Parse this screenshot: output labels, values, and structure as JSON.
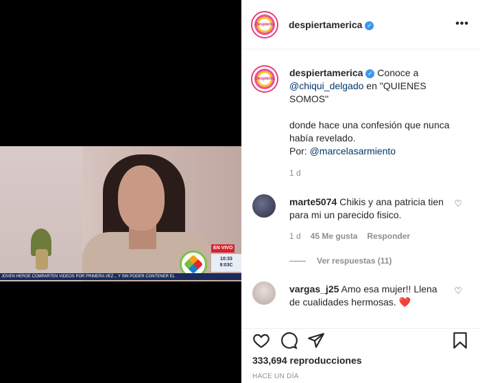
{
  "video": {
    "live_label": "EN VIVO",
    "clock_line1": "10:33",
    "clock_line2": "9:03C",
    "ticker": "JOVEN HEROE COMPARTEN VIDEOS POR PRIMERA VEZ... Y SIN PODER CONTENER EL"
  },
  "header": {
    "username": "despiertamerica",
    "avatar_text": "Despierta",
    "more": "•••"
  },
  "caption": {
    "username": "despiertamerica",
    "text_before": " Conoce a ",
    "mention1": "@chiqui_delgado",
    "text_mid": " en \"QUIENES SOMOS\"",
    "line2": "donde hace una confesión que nunca había revelado.",
    "por": "Por: ",
    "mention2": "@marcelasarmiento",
    "time": "1 d"
  },
  "comments": [
    {
      "username": "marte5074",
      "text": " Chikis y ana patricia tien para mi un parecido fisico.",
      "time": "1 d",
      "likes": "45 Me gusta",
      "reply": "Responder"
    },
    {
      "username": "vargas_j25",
      "text": " Amo esa mujer!! Llena de cualidades hermosas. ",
      "emoji": "❤️"
    }
  ],
  "view_replies": "Ver respuestas (11)",
  "actions": {
    "views": "333,694 reproducciones",
    "ago": "HACE UN DÍA"
  },
  "colors": {
    "accent": "#3897f0",
    "link": "#00376b",
    "muted": "#8e8e8e"
  }
}
